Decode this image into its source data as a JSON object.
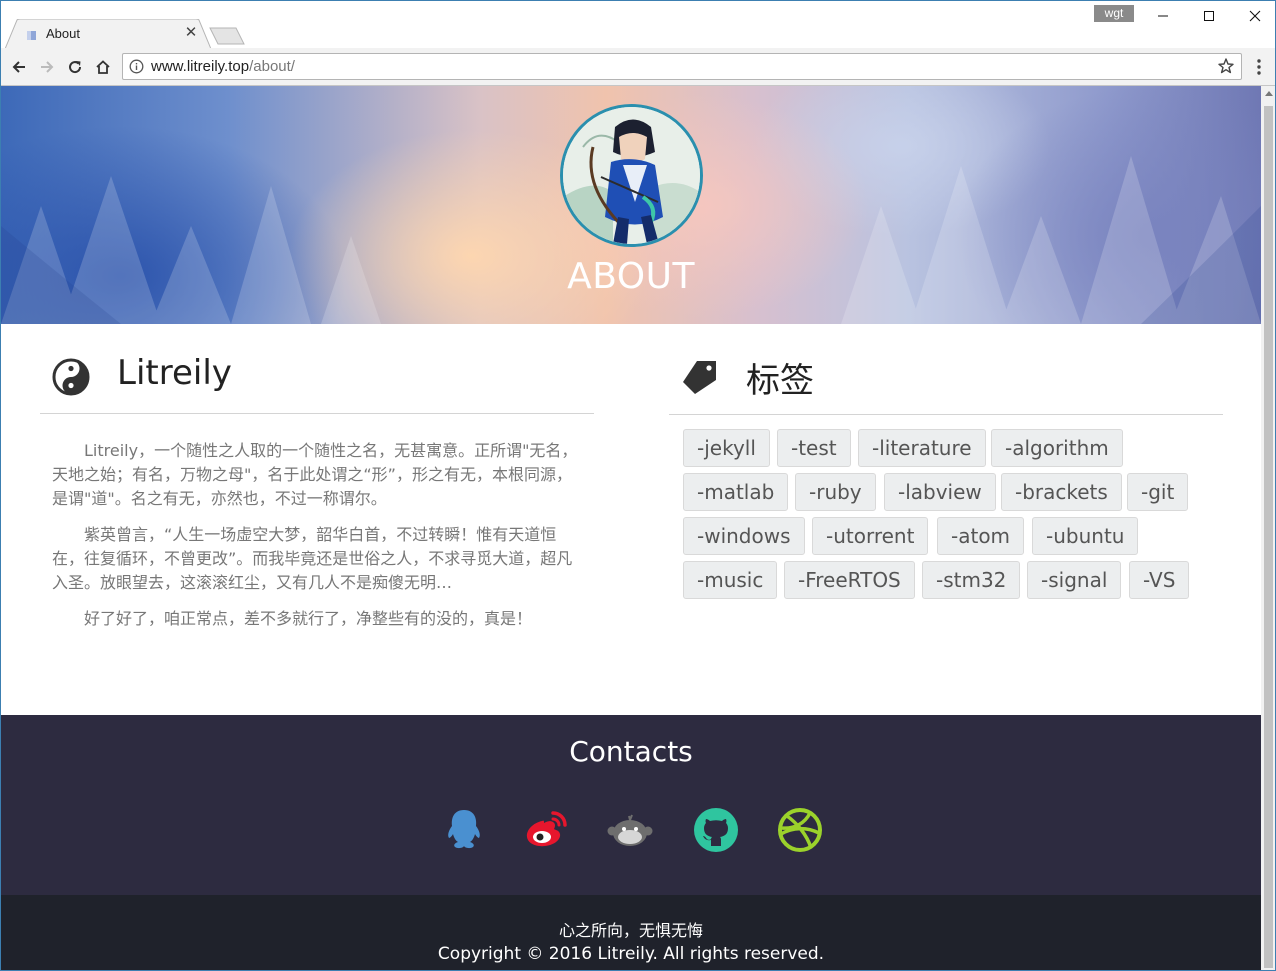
{
  "browser": {
    "tab_title": "About",
    "user_badge": "wgt",
    "url_host": "www.litreily.top",
    "url_path": "/about/"
  },
  "hero": {
    "title": "ABOUT"
  },
  "profile": {
    "name": "Litreily",
    "paragraphs": [
      "Litreily，一个随性之人取的一个随性之名，无甚寓意。正所谓\"无名，天地之始；有名，万物之母\"，名于此处谓之“形”，形之有无，本根同源，是谓\"道\"。名之有无，亦然也，不过一称谓尔。",
      "紫英曾言，“人生一场虚空大梦，韶华白首，不过转瞬！惟有天道恒在，往复循环，不曾更改”。而我毕竟还是世俗之人，不求寻觅大道，超凡入圣。放眼望去，这滚滚红尘，又有几人不是痴傻无明…",
      "好了好了，咱正常点，差不多就行了，净整些有的没的，真是！"
    ]
  },
  "tags": {
    "title": "标签",
    "items": [
      "-jekyll",
      "-test",
      "-literature",
      "-algorithm",
      "-matlab",
      "-ruby",
      "-labview",
      "-brackets",
      "-git",
      "-windows",
      "-utorrent",
      "-atom",
      "-ubuntu",
      "-music",
      "-FreeRTOS",
      "-stm32",
      "-signal",
      "-VS"
    ]
  },
  "contacts": {
    "title": "Contacts",
    "links": [
      {
        "icon": "qq-icon",
        "color": "#4a90d0"
      },
      {
        "icon": "weibo-icon",
        "color": "#e6162d"
      },
      {
        "icon": "monkey-icon",
        "color": "#6e6e6e"
      },
      {
        "icon": "github-icon",
        "color": "#2fc59f"
      },
      {
        "icon": "dribbble-icon",
        "color": "#9bd22b"
      }
    ]
  },
  "footer": {
    "motto": "心之所向，无惧无悔",
    "copyright": "Copyright © 2016 Litreily. All rights reserved."
  }
}
